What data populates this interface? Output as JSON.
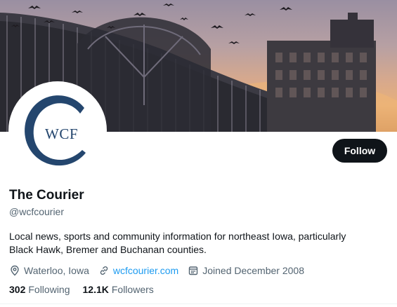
{
  "profile": {
    "avatar_text": "WCF",
    "name": "The Courier",
    "handle": "@wcfcourier",
    "bio_line1": "Local news, sports and community information for northeast Iowa, particularly",
    "bio_line2": "Black Hawk, Bremer and Buchanan counties.",
    "location": "Waterloo, Iowa",
    "website": "wcfcourier.com",
    "joined": "Joined December 2008",
    "following_count": "302",
    "following_label": "Following",
    "followers_count": "12.1K",
    "followers_label": "Followers"
  },
  "actions": {
    "follow_label": "Follow"
  },
  "icons": {
    "location": "location-pin-icon",
    "website": "link-icon",
    "joined": "calendar-icon"
  },
  "colors": {
    "accent": "#1d9bf0",
    "button_bg": "#0f1419",
    "secondary_text": "#536471",
    "logo_blue": "#24466e"
  }
}
